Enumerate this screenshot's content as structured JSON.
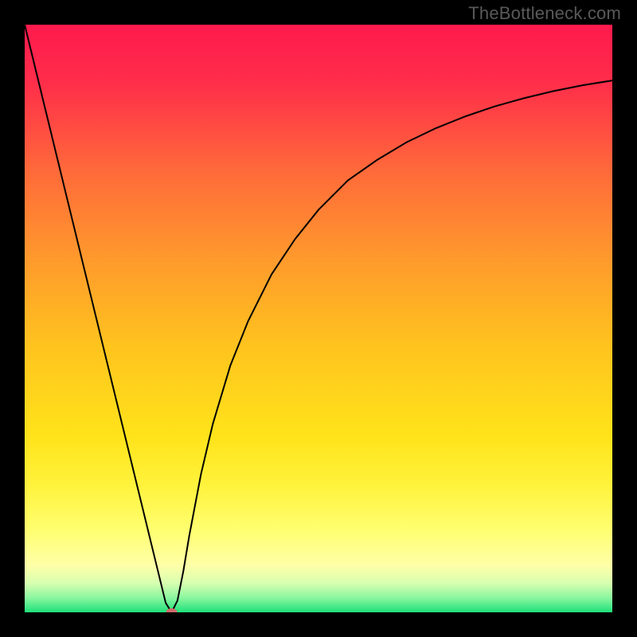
{
  "attribution": "TheBottleneck.com",
  "chart_data": {
    "type": "line",
    "title": "",
    "xlabel": "",
    "ylabel": "",
    "xlim": [
      0,
      100
    ],
    "ylim": [
      0,
      100
    ],
    "grid": false,
    "legend": false,
    "background_gradient": {
      "kind": "vertical-linear",
      "stops": [
        {
          "pos": 0.0,
          "color": "#ff1a4d"
        },
        {
          "pos": 0.1,
          "color": "#ff2e4a"
        },
        {
          "pos": 0.25,
          "color": "#ff6a3a"
        },
        {
          "pos": 0.4,
          "color": "#ff9a2c"
        },
        {
          "pos": 0.55,
          "color": "#ffc41e"
        },
        {
          "pos": 0.7,
          "color": "#ffe31a"
        },
        {
          "pos": 0.78,
          "color": "#fff23a"
        },
        {
          "pos": 0.86,
          "color": "#ffff70"
        },
        {
          "pos": 0.92,
          "color": "#ffffa8"
        },
        {
          "pos": 0.95,
          "color": "#d8ffb0"
        },
        {
          "pos": 0.975,
          "color": "#8cf7a0"
        },
        {
          "pos": 1.0,
          "color": "#1ee07a"
        }
      ]
    },
    "series": [
      {
        "name": "bottleneck-curve",
        "stroke": "#000000",
        "stroke_width": 2,
        "x": [
          0,
          2,
          4,
          6,
          8,
          10,
          12,
          14,
          16,
          18,
          20,
          22,
          24,
          25,
          26,
          27,
          28,
          30,
          32,
          35,
          38,
          42,
          46,
          50,
          55,
          60,
          65,
          70,
          75,
          80,
          85,
          90,
          95,
          100
        ],
        "y": [
          100.0,
          91.8,
          83.6,
          75.4,
          67.2,
          59.0,
          50.8,
          42.6,
          34.4,
          26.2,
          18.0,
          9.8,
          1.6,
          0.0,
          2.0,
          7.0,
          13.0,
          23.5,
          32.0,
          42.0,
          49.5,
          57.5,
          63.5,
          68.5,
          73.5,
          77.0,
          80.0,
          82.4,
          84.4,
          86.1,
          87.5,
          88.7,
          89.7,
          90.5
        ]
      }
    ],
    "marker": {
      "name": "minimum-marker",
      "x": 25,
      "y": 0,
      "color": "#d16a6a",
      "rx": 7,
      "ry": 5
    }
  }
}
